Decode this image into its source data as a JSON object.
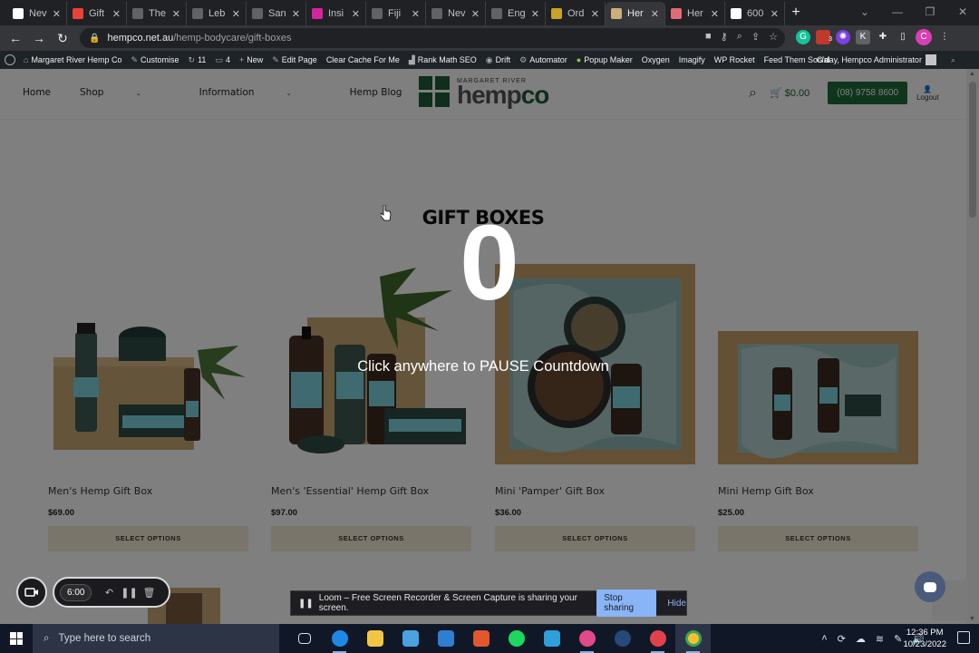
{
  "browser": {
    "tabs": [
      {
        "title": "Nev",
        "color": "#ffffff"
      },
      {
        "title": "Gift",
        "color": "#ea4335"
      },
      {
        "title": "The",
        "color": "#5f6368"
      },
      {
        "title": "Leb",
        "color": "#5f6368"
      },
      {
        "title": "San",
        "color": "#5f6368"
      },
      {
        "title": "Insi",
        "color": "#d6249f"
      },
      {
        "title": "Fiji",
        "color": "#5f6368"
      },
      {
        "title": "Nev",
        "color": "#5f6368"
      },
      {
        "title": "Eng",
        "color": "#5f6368"
      },
      {
        "title": "Ord",
        "color": "#c9a227"
      },
      {
        "title": "Her",
        "color": "#c9b27a",
        "active": true
      },
      {
        "title": "Her",
        "color": "#e06c75"
      },
      {
        "title": "600",
        "color": "#ffffff"
      }
    ],
    "new_tab": "+",
    "url_host": "hempco.net.au",
    "url_path": "/hemp-bodycare/gift-boxes",
    "profile_initial": "C",
    "ext_badge": "3"
  },
  "wp_admin": {
    "site": "Margaret River Hemp Co",
    "customise": "Customise",
    "updates": "11",
    "comments": "4",
    "new": "New",
    "edit_page": "Edit Page",
    "clear_cache": "Clear Cache For Me",
    "rank_math": "Rank Math SEO",
    "drift": "Drift",
    "automator": "Automator",
    "popup_maker": "Popup Maker",
    "oxygen": "Oxygen",
    "imagify": "Imagify",
    "wp_rocket": "WP Rocket",
    "feed": "Feed Them Social",
    "greeting": "G'day, Hempco Administrator"
  },
  "site": {
    "menu": [
      "Home",
      "Shop",
      "Information",
      "Hemp Blog"
    ],
    "logo_small": "MARGARET RIVER",
    "logo_hemp": "hemp",
    "logo_co": "co",
    "cart_total": "$0.00",
    "phone": "(08) 9758 8600",
    "logout": "Logout"
  },
  "page": {
    "heading": "GIFT BOXES",
    "products": [
      {
        "name": "Men's Hemp Gift Box",
        "price": "$69.00",
        "button": "SELECT OPTIONS"
      },
      {
        "name": "Men's 'Essential' Hemp Gift Box",
        "price": "$97.00",
        "button": "SELECT OPTIONS"
      },
      {
        "name": "Mini 'Pamper' Gift Box",
        "price": "$36.00",
        "button": "SELECT OPTIONS"
      },
      {
        "name": "Mini Hemp Gift Box",
        "price": "$25.00",
        "button": "SELECT OPTIONS"
      }
    ]
  },
  "countdown": {
    "digit": "0",
    "message": "Click anywhere to PAUSE Countdown"
  },
  "loom": {
    "timer": "6:00",
    "share_text": "Loom – Free Screen Recorder & Screen Capture is sharing your screen.",
    "stop_sharing": "Stop sharing",
    "hide": "Hide"
  },
  "taskbar": {
    "search_placeholder": "Type here to search",
    "time": "12:36 PM",
    "date": "10/23/2022"
  }
}
